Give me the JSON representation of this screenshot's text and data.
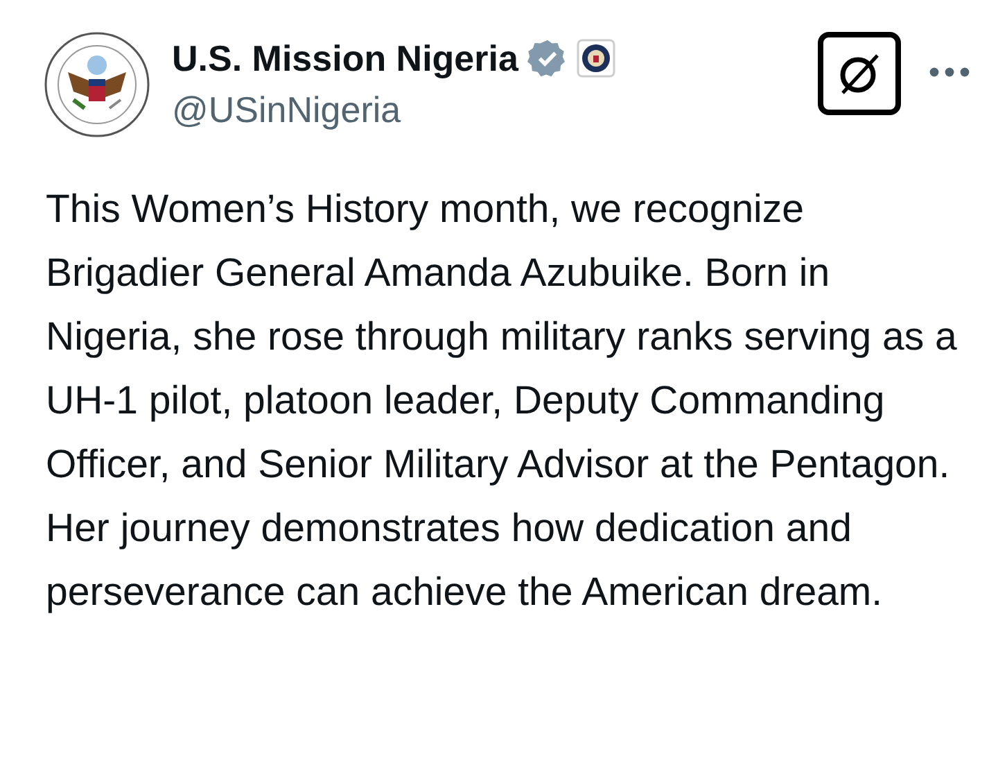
{
  "account": {
    "name": "U.S. Mission Nigeria",
    "handle": "@USinNigeria",
    "verified": true
  },
  "post": {
    "text": "This Women’s History month, we recognize Brigadier General Amanda Azubuike. Born in Nigeria, she rose through military ranks serving as a UH-1 pilot, platoon leader, Deputy Commanding Officer, and Senior Military Advisor at the Pentagon. Her journey demonstrates how dedication and perseverance can achieve the American dream."
  }
}
